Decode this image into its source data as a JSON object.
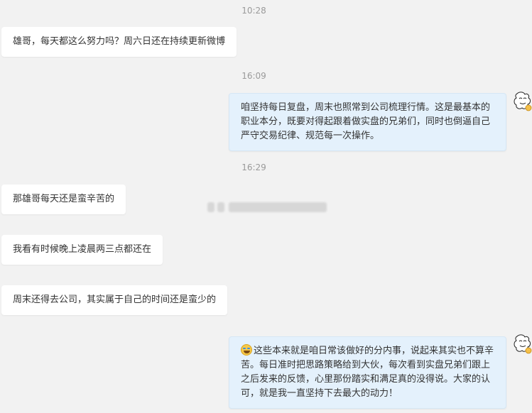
{
  "times": {
    "t1": "10:28",
    "t2": "16:09",
    "t3": "16:29"
  },
  "messages": {
    "m1": "雄哥，每天都这么努力吗？周六日还在持续更新微博",
    "m2": "咱坚持每日复盘，周末也照常到公司梳理行情。这是最基本的职业本分，既要对得起跟着做实盘的兄弟们，同时也倒逼自己严守交易纪律、规范每一次操作。",
    "m3": "那雄哥每天还是蛮辛苦的",
    "m4": "我看有时候晚上凌晨两三点都还在",
    "m5": "周末还得去公司，其实属于自己的时间还是蛮少的",
    "m6": "这些本来就是咱日常该做好的分内事，说起来其实也不算辛苦。每日准时把思路策略给到大伙，每次看到实盘兄弟们跟上之后发来的反馈，心里那份踏实和满足真的没得说。大家的认可，就是我一直坚持下去最大的动力！"
  },
  "icons": {
    "avatar": "avatar-icon",
    "emoji": "laughing-tears-emoji-icon"
  },
  "colors": {
    "background": "#f2f2f2",
    "incoming_bubble": "#ffffff",
    "outgoing_bubble": "#e4f1fc",
    "timestamp": "#9a9a9a"
  }
}
